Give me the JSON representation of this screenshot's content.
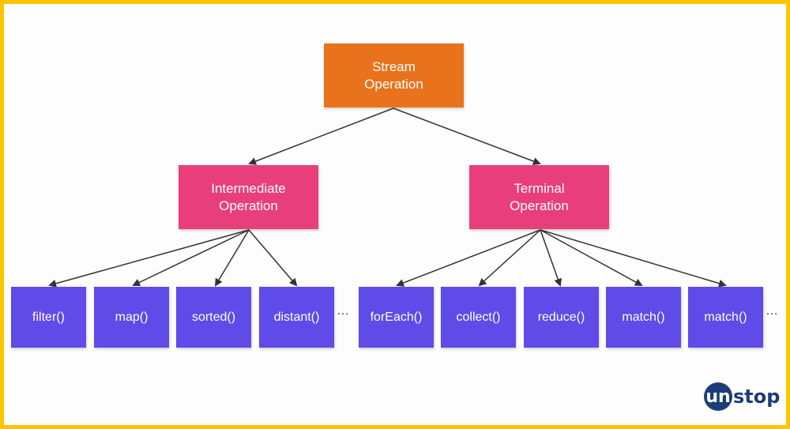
{
  "diagram": {
    "root": {
      "label_line1": "Stream",
      "label_line2": "Operation",
      "color": "#E8731C"
    },
    "intermediate": {
      "label_line1": "Intermediate",
      "label_line2": "Operation",
      "color": "#E83E79"
    },
    "terminal": {
      "label_line1": "Terminal",
      "label_line2": "Operation",
      "color": "#E83E79"
    },
    "intermediate_ops": [
      "filter()",
      "map()",
      "sorted()",
      "distant()"
    ],
    "terminal_ops": [
      "forEach()",
      "collect()",
      "reduce()",
      "match()",
      "match()"
    ],
    "leaf_color": "#604AE8",
    "ellipsis": "…",
    "edges": [
      {
        "from": "Stream Operation",
        "to": "Intermediate Operation"
      },
      {
        "from": "Stream Operation",
        "to": "Terminal Operation"
      },
      {
        "from": "Intermediate Operation",
        "to": "filter()"
      },
      {
        "from": "Intermediate Operation",
        "to": "map()"
      },
      {
        "from": "Intermediate Operation",
        "to": "sorted()"
      },
      {
        "from": "Intermediate Operation",
        "to": "distant()"
      },
      {
        "from": "Terminal Operation",
        "to": "forEach()"
      },
      {
        "from": "Terminal Operation",
        "to": "collect()"
      },
      {
        "from": "Terminal Operation",
        "to": "reduce()"
      },
      {
        "from": "Terminal Operation",
        "to": "match()"
      },
      {
        "from": "Terminal Operation",
        "to": "match() (2)"
      }
    ]
  },
  "branding": {
    "logo_circle_text": "un",
    "logo_rest_text": "stop",
    "border_color": "#FFC400"
  }
}
